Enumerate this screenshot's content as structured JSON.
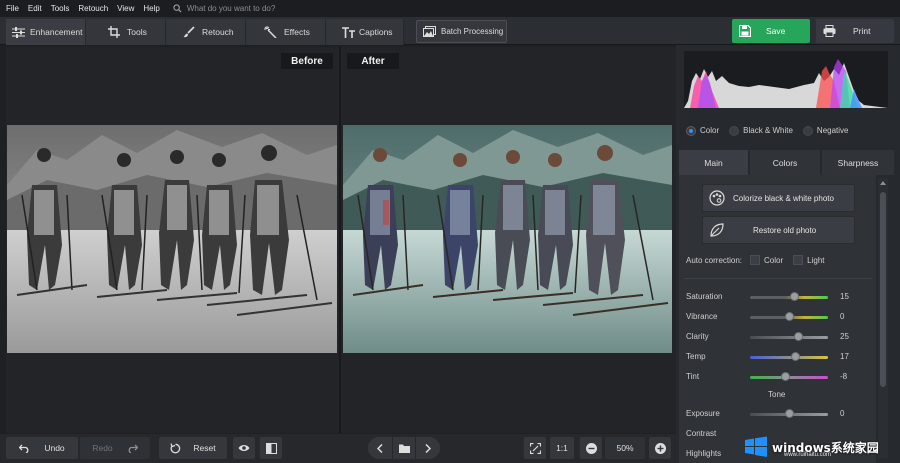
{
  "menu": [
    "File",
    "Edit",
    "Tools",
    "Retouch",
    "View",
    "Help"
  ],
  "search": {
    "placeholder": "What do you want to do?"
  },
  "tabs": [
    {
      "label": "Enhancement",
      "icon": "sliders-icon",
      "active": true
    },
    {
      "label": "Tools",
      "icon": "crop-icon"
    },
    {
      "label": "Retouch",
      "icon": "brush-icon"
    },
    {
      "label": "Effects",
      "icon": "magic-wand-icon"
    },
    {
      "label": "Captions",
      "icon": "text-icon"
    }
  ],
  "batch": {
    "label": "Batch Processing",
    "icon": "images-icon"
  },
  "save": {
    "label": "Save",
    "icon": "floppy-icon"
  },
  "print": {
    "label": "Print",
    "icon": "printer-icon"
  },
  "compare": {
    "before": "Before",
    "after": "After"
  },
  "bottom": {
    "undo": "Undo",
    "redo": "Redo",
    "reset": "Reset",
    "ratio": "1:1",
    "zoom": "50%"
  },
  "modes": [
    {
      "label": "Color",
      "selected": true
    },
    {
      "label": "Black & White",
      "selected": false
    },
    {
      "label": "Negative",
      "selected": false
    }
  ],
  "panel_tabs": [
    {
      "label": "Main",
      "active": true
    },
    {
      "label": "Colors",
      "active": false
    },
    {
      "label": "Sharpness",
      "active": false
    }
  ],
  "actions": {
    "colorize": "Colorize black & white photo",
    "restore": "Restore old photo"
  },
  "auto_correction": {
    "label": "Auto correction:",
    "color": "Color",
    "light": "Light"
  },
  "sliders": [
    {
      "name": "Saturation",
      "value": "15",
      "level": 0.57
    },
    {
      "name": "Vibrance",
      "value": "0",
      "level": 0.5
    },
    {
      "name": "Clarity",
      "value": "25",
      "level": 0.62
    },
    {
      "name": "Temp",
      "value": "17",
      "level": 0.58
    },
    {
      "name": "Tint",
      "value": "-8",
      "level": 0.46
    }
  ],
  "tone": {
    "title": "Tone",
    "sliders": [
      {
        "name": "Exposure",
        "value": "0",
        "level": 0.5
      },
      {
        "name": "Contrast",
        "value": "",
        "level": 0.5
      },
      {
        "name": "Highlights",
        "value": "",
        "level": 0.5
      }
    ]
  },
  "watermark": {
    "text": "windows系统家园",
    "url": "www.ruihaitu.com"
  },
  "colors": {
    "accent": "#3b8de8",
    "save": "#25a65b"
  }
}
